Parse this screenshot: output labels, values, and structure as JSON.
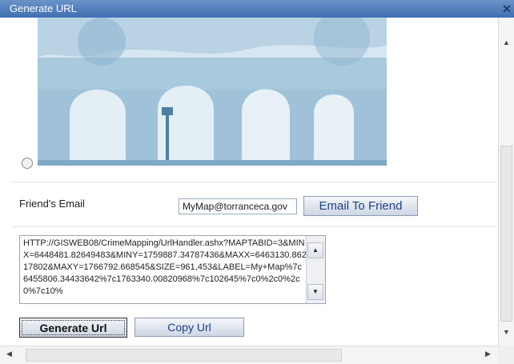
{
  "window": {
    "title": "Generate URL"
  },
  "email": {
    "label": "Friend's Email",
    "value": "MyMap@torranceca.gov",
    "button": "Email To Friend"
  },
  "url": {
    "value": "HTTP://GISWEB08/CrimeMapping/UrlHandler.ashx?MAPTABID=3&MINX=6448481.82649483&MINY=1759887.34787436&MAXX=6463130.86217802&MAXY=1766792.668545&SIZE=961,453&LABEL=My+Map%7c6455806.34433642%7c1763340.00820968%7c102645%7c0%2c0%2c0%7c10%"
  },
  "buttons": {
    "generate": "Generate Url",
    "copy": "Copy Url"
  },
  "icons": {
    "close": "close-icon",
    "scroll_up": "arrow-up-icon",
    "scroll_down": "arrow-down-icon",
    "scroll_left": "arrow-left-icon",
    "scroll_right": "arrow-right-icon"
  },
  "colors": {
    "titlebar": "#4a7bbf",
    "button_text": "#1f3f86",
    "photo_tint": "#bcd6e6"
  }
}
